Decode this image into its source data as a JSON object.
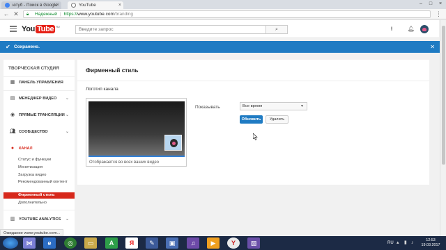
{
  "browser": {
    "tabs": [
      {
        "label": "ютуб - Поиск в Google",
        "active": false
      },
      {
        "label": "YouTube",
        "active": true
      }
    ],
    "address": {
      "secure_label": "Надежный",
      "scheme": "https://",
      "host": "www.youtube.com",
      "path": "/branding"
    }
  },
  "yt_header": {
    "logo_you": "You",
    "logo_tube": "Tube",
    "logo_region": "RU",
    "search_placeholder": "Введите запрос"
  },
  "banner": {
    "text": "Сохранено."
  },
  "sidebar": {
    "title": "ТВОРЧЕСКАЯ СТУДИЯ",
    "items": [
      {
        "label": "ПАНЕЛЬ УПРАВЛЕНИЯ",
        "icon": "dashboard-icon"
      },
      {
        "label": "МЕНЕДЖЕР ВИДЕО",
        "icon": "video-manager-icon"
      },
      {
        "label": "ПРЯМЫЕ ТРАНСЛЯЦИИ",
        "icon": "live-icon"
      },
      {
        "label": "СООБЩЕСТВО",
        "icon": "community-icon"
      },
      {
        "label": "КАНАЛ",
        "icon": "channel-icon"
      }
    ],
    "channel_sub": [
      "Статус и функции",
      "Монетизация",
      "Загрузка видео",
      "Рекомендованный контент",
      "Фирменный стиль",
      "Дополнительно"
    ],
    "analytics_label": "YOUTUBE ANALYTICS"
  },
  "main": {
    "title": "Фирменный стиль",
    "section_label": "Логотип канала",
    "preview_caption": "Отображается во всех ваших видео",
    "show_label": "Показывать",
    "show_value": "Все время",
    "update_button": "Обновить",
    "delete_button": "Удалить"
  },
  "status_bar": "Ожидание www.youtube.com...",
  "taskbar": {
    "lang": "RU",
    "time": "12:53",
    "date": "19.03.2017"
  },
  "colors": {
    "accent_blue": "#1f7bc3",
    "youtube_red": "#e62117",
    "active_red": "#d7281b"
  }
}
